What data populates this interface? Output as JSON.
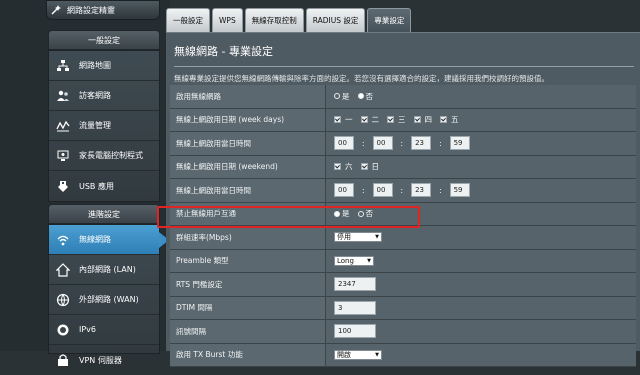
{
  "sidebar": {
    "top_button": "網路設定精靈",
    "section_general": "一般設定",
    "general_items": [
      {
        "label": "網路地圖",
        "icon": "network-map-icon"
      },
      {
        "label": "訪客網路",
        "icon": "guest-network-icon"
      },
      {
        "label": "流量管理",
        "icon": "traffic-manager-icon"
      },
      {
        "label": "家長電腦控制程式",
        "icon": "parental-control-icon"
      },
      {
        "label": "USB 應用",
        "icon": "usb-application-icon"
      }
    ],
    "section_advanced": "進階設定",
    "advanced_items": [
      {
        "label": "無線網路",
        "icon": "wireless-icon",
        "active": true
      },
      {
        "label": "內部網路 (LAN)",
        "icon": "lan-icon"
      },
      {
        "label": "外部網路 (WAN)",
        "icon": "wan-icon"
      },
      {
        "label": "IPv6",
        "icon": "ipv6-icon"
      },
      {
        "label": "VPN 伺服器",
        "icon": "vpn-icon"
      }
    ]
  },
  "tabs": [
    "一般設定",
    "WPS",
    "無線存取控制",
    "RADIUS 設定",
    "專業設定"
  ],
  "active_tab": "專業設定",
  "page": {
    "title": "無線網路 - 專業設定",
    "description": "無線專業設定提供您無線網路傳輸與除率方面的設定。若您沒有選擇適合的設定，建議採用我們校調好的預設值。"
  },
  "common": {
    "yes": "是",
    "no": "否",
    "colon": ":"
  },
  "settings": {
    "enable_radio": {
      "label": "啟用無線網路",
      "selected": "否"
    },
    "weekday_days": {
      "label": "無線上網啟用日期 (week days)",
      "days": [
        {
          "name": "一",
          "checked": true
        },
        {
          "name": "二",
          "checked": true
        },
        {
          "name": "三",
          "checked": true
        },
        {
          "name": "四",
          "checked": true
        },
        {
          "name": "五",
          "checked": true
        }
      ]
    },
    "weekday_time": {
      "label": "無線上網啟用當日時間",
      "start_h": "00",
      "start_m": "00",
      "end_h": "23",
      "end_m": "59"
    },
    "weekend_days": {
      "label": "無線上網啟用日期 (weekend)",
      "days": [
        {
          "name": "六",
          "checked": true
        },
        {
          "name": "日",
          "checked": true
        }
      ]
    },
    "weekend_time": {
      "label": "無線上網啟用當日時間",
      "start_h": "00",
      "start_m": "00",
      "end_h": "23",
      "end_m": "59"
    },
    "ap_isolation": {
      "label": "禁止無線用戶互通",
      "selected": "是"
    },
    "multicast_rate": {
      "label": "群組速率(Mbps)",
      "value": "停用"
    },
    "preamble": {
      "label": "Preamble 類型",
      "value": "Long"
    },
    "rts": {
      "label": "RTS 門檻設定",
      "value": "2347"
    },
    "dtim": {
      "label": "DTIM 間隔",
      "value": "3"
    },
    "beacon": {
      "label": "訊號間隔",
      "value": "100"
    },
    "tx_burst": {
      "label": "啟用 TX Burst 功能",
      "value": "開啟"
    }
  },
  "colors": {
    "highlight": "#e02323",
    "active_nav": "#3c8fc6"
  }
}
